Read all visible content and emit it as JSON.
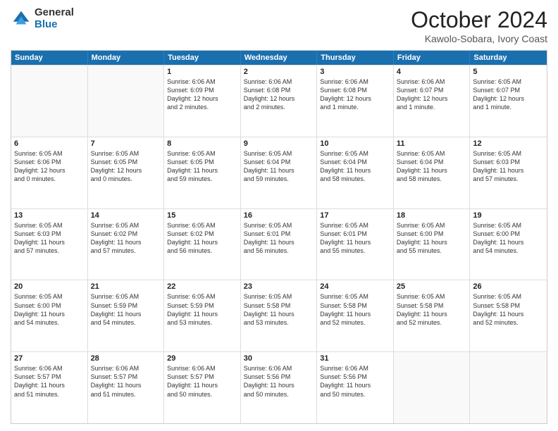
{
  "logo": {
    "general": "General",
    "blue": "Blue"
  },
  "title": {
    "month": "October 2024",
    "location": "Kawolo-Sobara, Ivory Coast"
  },
  "header": {
    "days": [
      "Sunday",
      "Monday",
      "Tuesday",
      "Wednesday",
      "Thursday",
      "Friday",
      "Saturday"
    ]
  },
  "weeks": [
    [
      {
        "day": "",
        "text": "",
        "empty": true
      },
      {
        "day": "",
        "text": "",
        "empty": true
      },
      {
        "day": "1",
        "text": "Sunrise: 6:06 AM\nSunset: 6:09 PM\nDaylight: 12 hours\nand 2 minutes."
      },
      {
        "day": "2",
        "text": "Sunrise: 6:06 AM\nSunset: 6:08 PM\nDaylight: 12 hours\nand 2 minutes."
      },
      {
        "day": "3",
        "text": "Sunrise: 6:06 AM\nSunset: 6:08 PM\nDaylight: 12 hours\nand 1 minute."
      },
      {
        "day": "4",
        "text": "Sunrise: 6:06 AM\nSunset: 6:07 PM\nDaylight: 12 hours\nand 1 minute."
      },
      {
        "day": "5",
        "text": "Sunrise: 6:05 AM\nSunset: 6:07 PM\nDaylight: 12 hours\nand 1 minute."
      }
    ],
    [
      {
        "day": "6",
        "text": "Sunrise: 6:05 AM\nSunset: 6:06 PM\nDaylight: 12 hours\nand 0 minutes."
      },
      {
        "day": "7",
        "text": "Sunrise: 6:05 AM\nSunset: 6:05 PM\nDaylight: 12 hours\nand 0 minutes."
      },
      {
        "day": "8",
        "text": "Sunrise: 6:05 AM\nSunset: 6:05 PM\nDaylight: 11 hours\nand 59 minutes."
      },
      {
        "day": "9",
        "text": "Sunrise: 6:05 AM\nSunset: 6:04 PM\nDaylight: 11 hours\nand 59 minutes."
      },
      {
        "day": "10",
        "text": "Sunrise: 6:05 AM\nSunset: 6:04 PM\nDaylight: 11 hours\nand 58 minutes."
      },
      {
        "day": "11",
        "text": "Sunrise: 6:05 AM\nSunset: 6:04 PM\nDaylight: 11 hours\nand 58 minutes."
      },
      {
        "day": "12",
        "text": "Sunrise: 6:05 AM\nSunset: 6:03 PM\nDaylight: 11 hours\nand 57 minutes."
      }
    ],
    [
      {
        "day": "13",
        "text": "Sunrise: 6:05 AM\nSunset: 6:03 PM\nDaylight: 11 hours\nand 57 minutes."
      },
      {
        "day": "14",
        "text": "Sunrise: 6:05 AM\nSunset: 6:02 PM\nDaylight: 11 hours\nand 57 minutes."
      },
      {
        "day": "15",
        "text": "Sunrise: 6:05 AM\nSunset: 6:02 PM\nDaylight: 11 hours\nand 56 minutes."
      },
      {
        "day": "16",
        "text": "Sunrise: 6:05 AM\nSunset: 6:01 PM\nDaylight: 11 hours\nand 56 minutes."
      },
      {
        "day": "17",
        "text": "Sunrise: 6:05 AM\nSunset: 6:01 PM\nDaylight: 11 hours\nand 55 minutes."
      },
      {
        "day": "18",
        "text": "Sunrise: 6:05 AM\nSunset: 6:00 PM\nDaylight: 11 hours\nand 55 minutes."
      },
      {
        "day": "19",
        "text": "Sunrise: 6:05 AM\nSunset: 6:00 PM\nDaylight: 11 hours\nand 54 minutes."
      }
    ],
    [
      {
        "day": "20",
        "text": "Sunrise: 6:05 AM\nSunset: 6:00 PM\nDaylight: 11 hours\nand 54 minutes."
      },
      {
        "day": "21",
        "text": "Sunrise: 6:05 AM\nSunset: 5:59 PM\nDaylight: 11 hours\nand 54 minutes."
      },
      {
        "day": "22",
        "text": "Sunrise: 6:05 AM\nSunset: 5:59 PM\nDaylight: 11 hours\nand 53 minutes."
      },
      {
        "day": "23",
        "text": "Sunrise: 6:05 AM\nSunset: 5:58 PM\nDaylight: 11 hours\nand 53 minutes."
      },
      {
        "day": "24",
        "text": "Sunrise: 6:05 AM\nSunset: 5:58 PM\nDaylight: 11 hours\nand 52 minutes."
      },
      {
        "day": "25",
        "text": "Sunrise: 6:05 AM\nSunset: 5:58 PM\nDaylight: 11 hours\nand 52 minutes."
      },
      {
        "day": "26",
        "text": "Sunrise: 6:05 AM\nSunset: 5:58 PM\nDaylight: 11 hours\nand 52 minutes."
      }
    ],
    [
      {
        "day": "27",
        "text": "Sunrise: 6:06 AM\nSunset: 5:57 PM\nDaylight: 11 hours\nand 51 minutes."
      },
      {
        "day": "28",
        "text": "Sunrise: 6:06 AM\nSunset: 5:57 PM\nDaylight: 11 hours\nand 51 minutes."
      },
      {
        "day": "29",
        "text": "Sunrise: 6:06 AM\nSunset: 5:57 PM\nDaylight: 11 hours\nand 50 minutes."
      },
      {
        "day": "30",
        "text": "Sunrise: 6:06 AM\nSunset: 5:56 PM\nDaylight: 11 hours\nand 50 minutes."
      },
      {
        "day": "31",
        "text": "Sunrise: 6:06 AM\nSunset: 5:56 PM\nDaylight: 11 hours\nand 50 minutes."
      },
      {
        "day": "",
        "text": "",
        "empty": true
      },
      {
        "day": "",
        "text": "",
        "empty": true
      }
    ]
  ]
}
